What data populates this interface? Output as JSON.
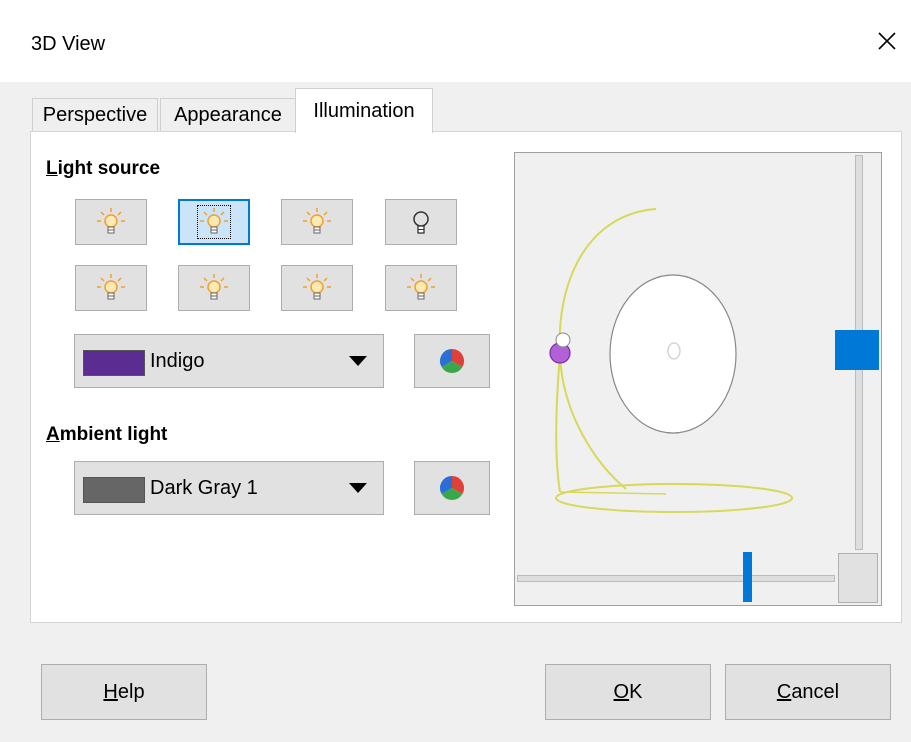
{
  "window": {
    "title": "3D View"
  },
  "tabs": [
    {
      "label": "Perspective"
    },
    {
      "label": "Appearance"
    },
    {
      "label": "Illumination"
    }
  ],
  "light_source": {
    "heading_underlined_char": "L",
    "heading_rest": "ight source",
    "buttons": [
      {
        "icon": "light-bulb-on-icon",
        "state": "normal"
      },
      {
        "icon": "light-bulb-on-icon",
        "state": "selected"
      },
      {
        "icon": "light-bulb-on-icon",
        "state": "normal"
      },
      {
        "icon": "light-bulb-off-icon",
        "state": "normal"
      },
      {
        "icon": "light-bulb-on-icon",
        "state": "normal"
      },
      {
        "icon": "light-bulb-on-icon",
        "state": "normal"
      },
      {
        "icon": "light-bulb-on-icon",
        "state": "normal"
      },
      {
        "icon": "light-bulb-on-icon",
        "state": "normal"
      }
    ],
    "color": {
      "label": "Indigo",
      "swatch": "#5b2c91"
    },
    "color_button_icon": "color-picker-icon"
  },
  "ambient_light": {
    "heading_underlined_char": "A",
    "heading_rest": "mbient light",
    "color": {
      "label": "Dark Gray 1",
      "swatch": "#666666"
    },
    "color_button_icon": "color-picker-icon"
  },
  "buttons": {
    "help_u": "H",
    "help_rest": "elp",
    "ok_u": "O",
    "ok_rest": "K",
    "cancel_u": "C",
    "cancel_rest": "ancel"
  },
  "colors": {
    "accent": "#0078d7",
    "light_wire": "#d8d85a"
  }
}
